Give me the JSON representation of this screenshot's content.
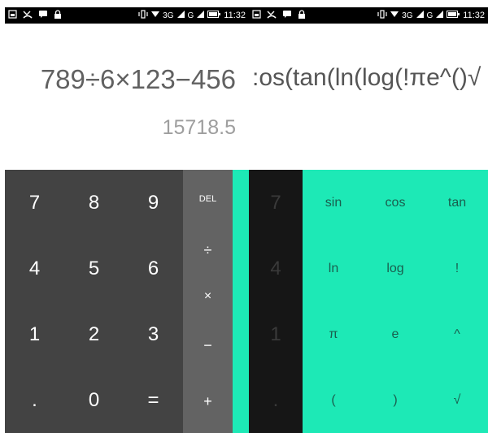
{
  "left_screen": {
    "status_bar": {
      "left_icons": [
        "image-icon",
        "missed-call-icon",
        "message-icon",
        "lock-icon"
      ],
      "vibrate_icon": "vibrate-icon",
      "network": "3G",
      "network2": "G",
      "battery_icon": "battery-icon",
      "time": "11:32"
    },
    "display": {
      "formula": "789÷6×123−456",
      "result": "15718.5"
    },
    "numpad": [
      {
        "label": "7",
        "name": "key-7"
      },
      {
        "label": "8",
        "name": "key-8"
      },
      {
        "label": "9",
        "name": "key-9"
      },
      {
        "label": "4",
        "name": "key-4"
      },
      {
        "label": "5",
        "name": "key-5"
      },
      {
        "label": "6",
        "name": "key-6"
      },
      {
        "label": "1",
        "name": "key-1"
      },
      {
        "label": "2",
        "name": "key-2"
      },
      {
        "label": "3",
        "name": "key-3"
      },
      {
        "label": ".",
        "name": "key-decimal"
      },
      {
        "label": "0",
        "name": "key-0"
      },
      {
        "label": "=",
        "name": "key-equals"
      }
    ],
    "operators": {
      "del": "DEL",
      "divide": "÷",
      "multiply": "×",
      "subtract": "−",
      "add": "+"
    }
  },
  "right_screen": {
    "status_bar": {
      "left_icons": [
        "image-icon",
        "missed-call-icon",
        "message-icon",
        "lock-icon"
      ],
      "vibrate_icon": "vibrate-icon",
      "network": "3G",
      "network2": "G",
      "battery_icon": "battery-icon",
      "time": "11:32"
    },
    "display": {
      "formula": ":os(tan(ln(log(!πe^()√"
    },
    "dim_numpad": [
      "7",
      "4",
      "1",
      "."
    ],
    "advanced": [
      {
        "label": "sin",
        "name": "adv-key-sin"
      },
      {
        "label": "cos",
        "name": "adv-key-cos"
      },
      {
        "label": "tan",
        "name": "adv-key-tan"
      },
      {
        "label": "ln",
        "name": "adv-key-ln"
      },
      {
        "label": "log",
        "name": "adv-key-log"
      },
      {
        "label": "!",
        "name": "adv-key-factorial"
      },
      {
        "label": "π",
        "name": "adv-key-pi"
      },
      {
        "label": "e",
        "name": "adv-key-e"
      },
      {
        "label": "^",
        "name": "adv-key-power"
      },
      {
        "label": "(",
        "name": "adv-key-open-paren"
      },
      {
        "label": ")",
        "name": "adv-key-close-paren"
      },
      {
        "label": "√",
        "name": "adv-key-sqrt"
      }
    ]
  },
  "colors": {
    "numpad_bg": "#434343",
    "operator_bg": "#636363",
    "accent": "#1de9b6",
    "dark_numpad_bg": "#161616"
  }
}
